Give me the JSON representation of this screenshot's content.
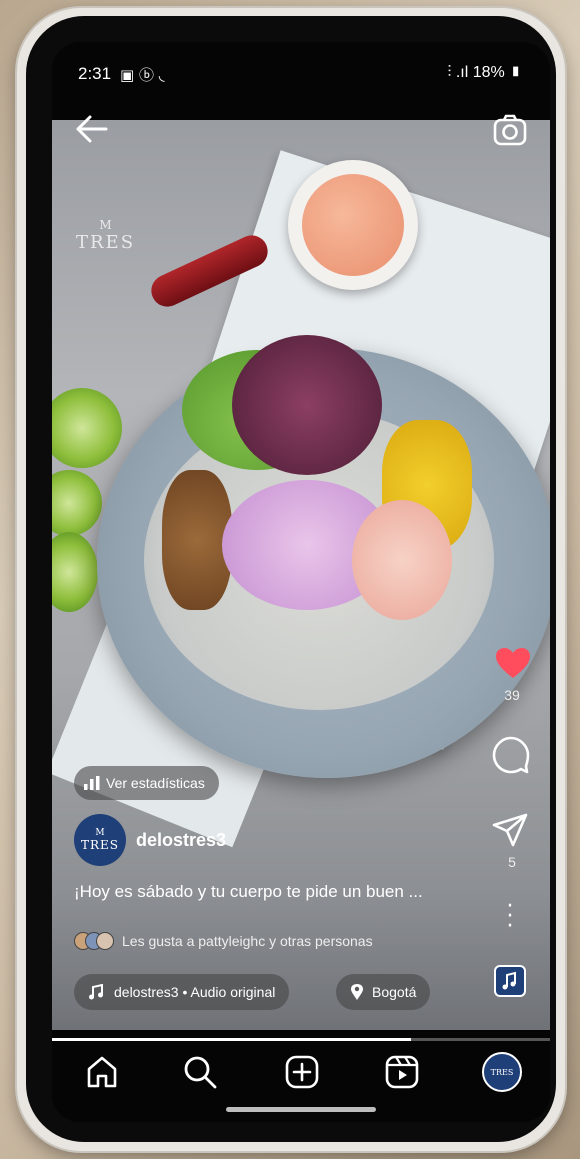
{
  "status_bar": {
    "time": "2:31",
    "left_icons": "▣ ⓑ ◟",
    "right_text": "18%"
  },
  "reel": {
    "logo_mark": "M",
    "logo_text": "TRES",
    "stats_label": "Ver estadísticas",
    "author_name": "delostres3",
    "avatar_mark": "M",
    "avatar_text": "TRES",
    "caption": "¡Hoy es sábado y tu cuerpo te pide un buen ...",
    "liked_by": "Les gusta a pattyleighc y otras personas",
    "audio_label": "delostres3 • Audio original",
    "location": "Bogotá",
    "like_count": "39",
    "share_count": "5",
    "progress": 0.72
  },
  "bottom_nav": {
    "profile_text": "TRES"
  },
  "colors": {
    "heart": "#ff4d5e",
    "brand_blue": "#1f3f78"
  },
  "icons": [
    "back-arrow-icon",
    "camera-icon",
    "heart-icon",
    "comment-icon",
    "share-icon",
    "more-icon",
    "bar-chart-icon",
    "music-note-icon",
    "location-pin-icon",
    "home-icon",
    "search-icon",
    "create-icon",
    "reels-icon"
  ]
}
